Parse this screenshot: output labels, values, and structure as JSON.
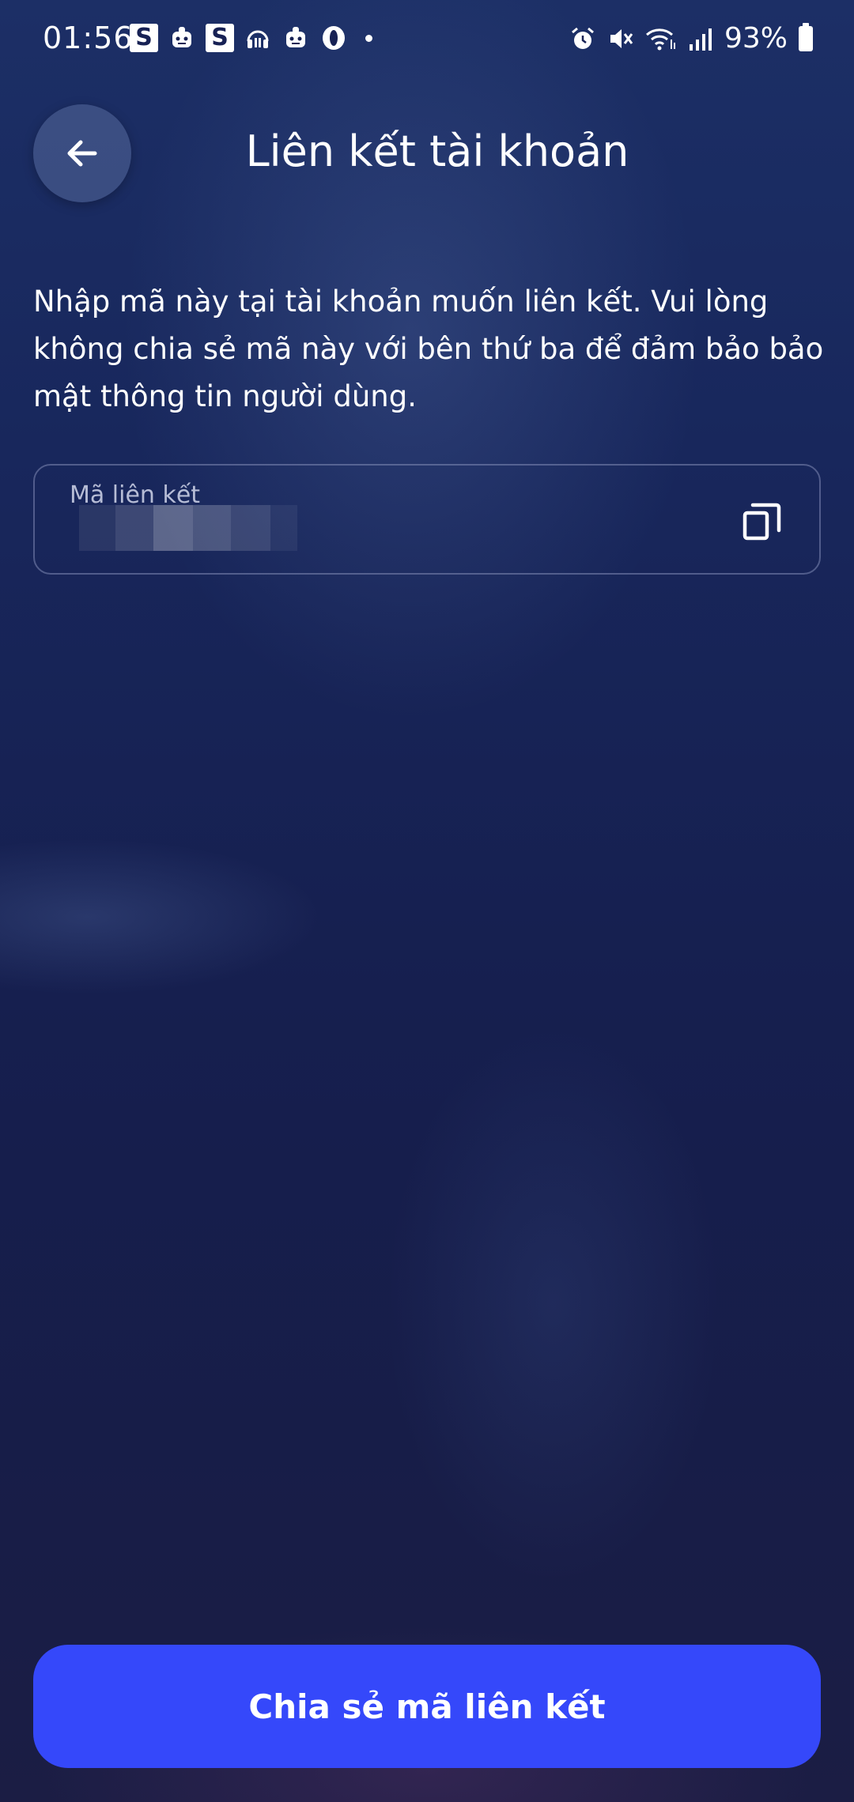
{
  "status_bar": {
    "time": "01:56",
    "badge_1": "S",
    "badge_2": "S",
    "battery": "93%"
  },
  "header": {
    "title": "Liên kết tài khoản"
  },
  "description": "Nhập mã này tại tài khoản muốn liên kết. Vui lòng không chia sẻ mã này với bên thứ ba để đảm bảo bảo mật thông tin người dùng.",
  "code_field": {
    "label": "Mã liên kết"
  },
  "share_button": {
    "label": "Chia sẻ mã liên kết"
  },
  "colors": {
    "primary_button": "#3548fa",
    "background": "#172154"
  },
  "icons": {
    "back": "arrow-left-icon",
    "copy": "copy-icon"
  }
}
